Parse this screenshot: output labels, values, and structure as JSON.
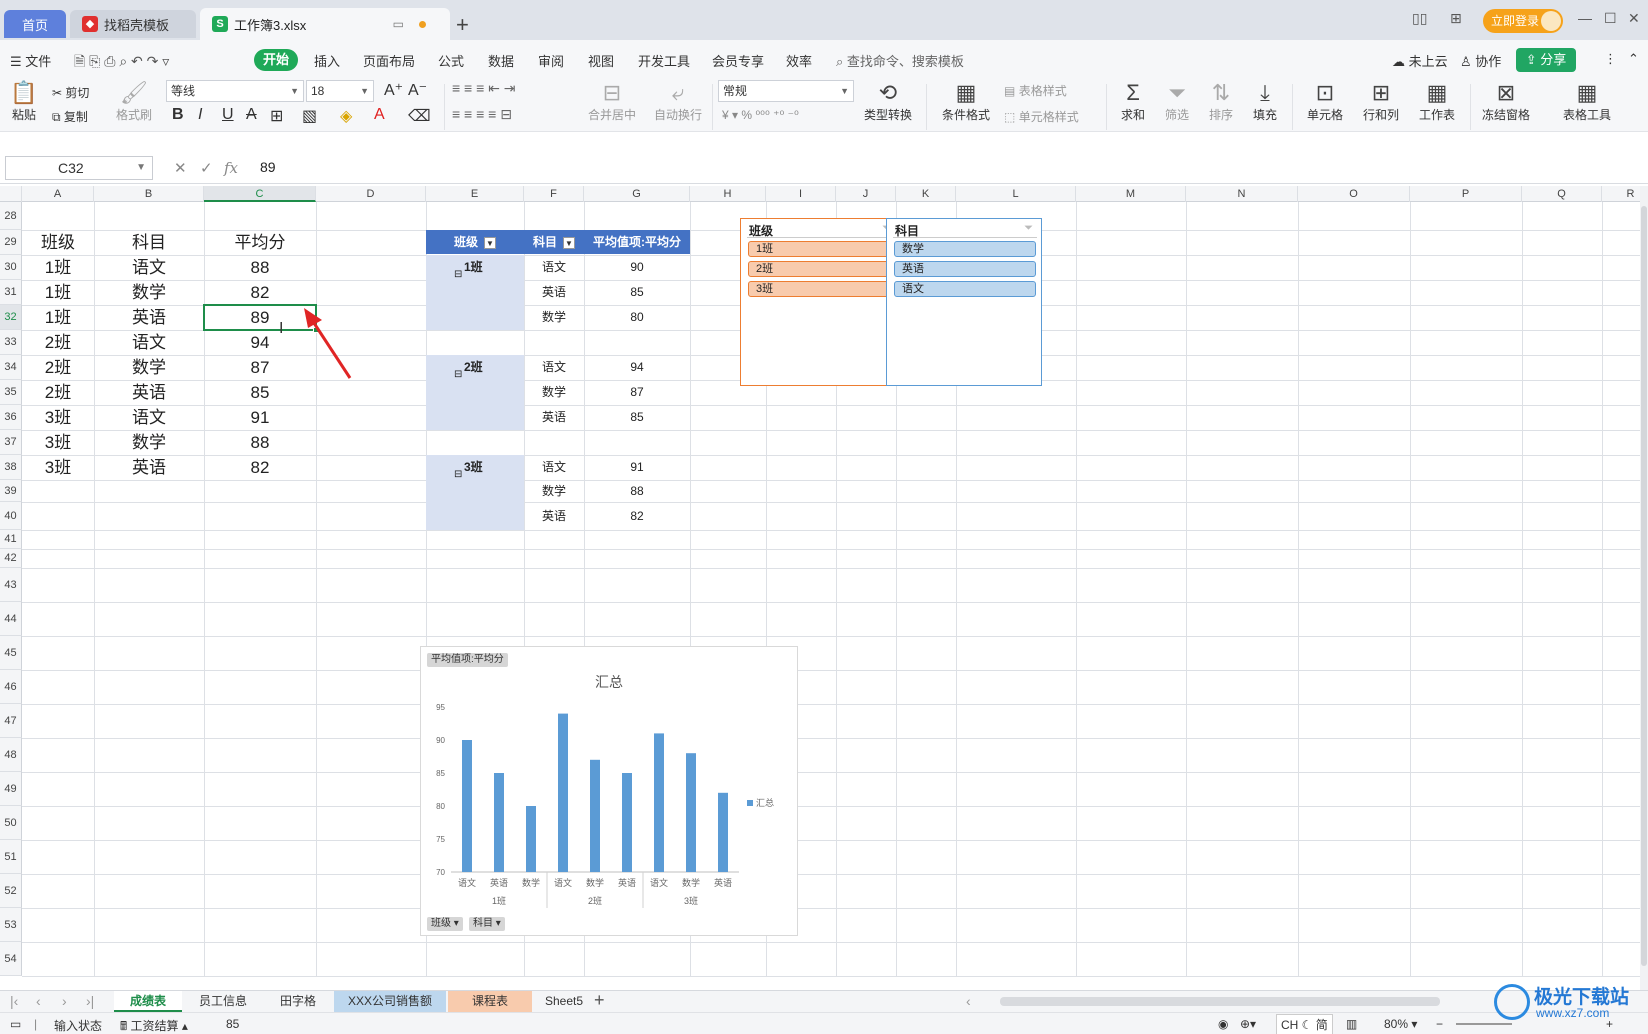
{
  "titlebar": {
    "tabs": [
      "首页",
      "找稻壳模板",
      "工作簿3.xlsx"
    ],
    "login_label": "立即登录"
  },
  "menubar": {
    "file": "文件",
    "items": [
      "开始",
      "插入",
      "页面布局",
      "公式",
      "数据",
      "审阅",
      "视图",
      "开发工具",
      "会员专享",
      "效率"
    ],
    "search_placeholder": "查找命令、搜索模板",
    "cloud": "未上云",
    "collab": "协作",
    "share": "分享"
  },
  "ribbon": {
    "paste": "粘贴",
    "cut": "剪切",
    "copy": "复制",
    "format_painter": "格式刷",
    "font_name": "等线",
    "font_size": "18",
    "merge_center": "合并居中",
    "wrap": "自动换行",
    "number_format": "常规",
    "type_convert": "类型转换",
    "cond_format": "条件格式",
    "table_style": "表格样式",
    "cell_style": "单元格样式",
    "sum": "求和",
    "filter": "筛选",
    "sort": "排序",
    "fill": "填充",
    "cells": "单元格",
    "rows_cols": "行和列",
    "worksheet": "工作表",
    "freeze": "冻结窗格",
    "table_tools": "表格工具"
  },
  "formula_bar": {
    "cell_ref": "C32",
    "value": "89",
    "fx": "fx"
  },
  "columns": [
    "A",
    "B",
    "C",
    "D",
    "E",
    "F",
    "G",
    "H",
    "I",
    "J",
    "K",
    "L",
    "M",
    "N",
    "O",
    "P",
    "Q",
    "R"
  ],
  "rows": [
    "28",
    "29",
    "30",
    "31",
    "32",
    "33",
    "34",
    "35",
    "36",
    "37",
    "38",
    "39",
    "40",
    "41",
    "42",
    "43",
    "44",
    "45",
    "46",
    "47",
    "48",
    "49",
    "50",
    "51",
    "52",
    "53",
    "54"
  ],
  "data_table": {
    "headers": [
      "班级",
      "科目",
      "平均分"
    ],
    "rows": [
      [
        "1班",
        "语文",
        "88"
      ],
      [
        "1班",
        "数学",
        "82"
      ],
      [
        "1班",
        "英语",
        "89"
      ],
      [
        "2班",
        "语文",
        "94"
      ],
      [
        "2班",
        "数学",
        "87"
      ],
      [
        "2班",
        "英语",
        "85"
      ],
      [
        "3班",
        "语文",
        "91"
      ],
      [
        "3班",
        "数学",
        "88"
      ],
      [
        "3班",
        "英语",
        "82"
      ]
    ]
  },
  "pivot": {
    "headers": [
      "班级",
      "科目",
      "平均值项:平均分"
    ],
    "groups": [
      {
        "class": "1班",
        "items": [
          [
            "语文",
            "90"
          ],
          [
            "英语",
            "85"
          ],
          [
            "数学",
            "80"
          ]
        ]
      },
      {
        "class": "2班",
        "items": [
          [
            "语文",
            "94"
          ],
          [
            "数学",
            "87"
          ],
          [
            "英语",
            "85"
          ]
        ]
      },
      {
        "class": "3班",
        "items": [
          [
            "语文",
            "91"
          ],
          [
            "数学",
            "88"
          ],
          [
            "英语",
            "82"
          ]
        ]
      }
    ],
    "collapse_symbol": "⊟"
  },
  "slicers": [
    {
      "title": "班级",
      "items": [
        "1班",
        "2班",
        "3班"
      ],
      "color": "#f8cbad",
      "border": "#ed7d31"
    },
    {
      "title": "科目",
      "items": [
        "数学",
        "英语",
        "语文"
      ],
      "color": "#bdd7ee",
      "border": "#5b9bd5"
    }
  ],
  "chart_data": {
    "type": "bar",
    "title": "汇总",
    "field_chip": "平均值项:平均分",
    "legend": "汇总",
    "legend_position": "right",
    "axis_chips": [
      "班级",
      "科目"
    ],
    "groups": [
      "1班",
      "2班",
      "3班"
    ],
    "categories": [
      "语文",
      "英语",
      "数学",
      "语文",
      "数学",
      "英语",
      "语文",
      "数学",
      "英语"
    ],
    "values": [
      90,
      85,
      80,
      94,
      87,
      85,
      91,
      88,
      82
    ],
    "yticks": [
      70,
      75,
      80,
      85,
      90,
      95
    ],
    "ylim": [
      70,
      95
    ],
    "bar_color": "#5b9bd5"
  },
  "sheet_tabs": [
    "成绩表",
    "员工信息",
    "田字格",
    "XXX公司销售额",
    "课程表",
    "Sheet5"
  ],
  "sheet_tab_colors": [
    "",
    "",
    "",
    "#bdd7ee",
    "#f8cbad",
    ""
  ],
  "statusbar": {
    "input_state": "输入状态",
    "salary": "工资结算",
    "value": "85",
    "ime": "CH",
    "ime2": "简",
    "zoom": "80%"
  },
  "watermark": {
    "title": "极光下载站",
    "url": "www.xz7.com"
  }
}
